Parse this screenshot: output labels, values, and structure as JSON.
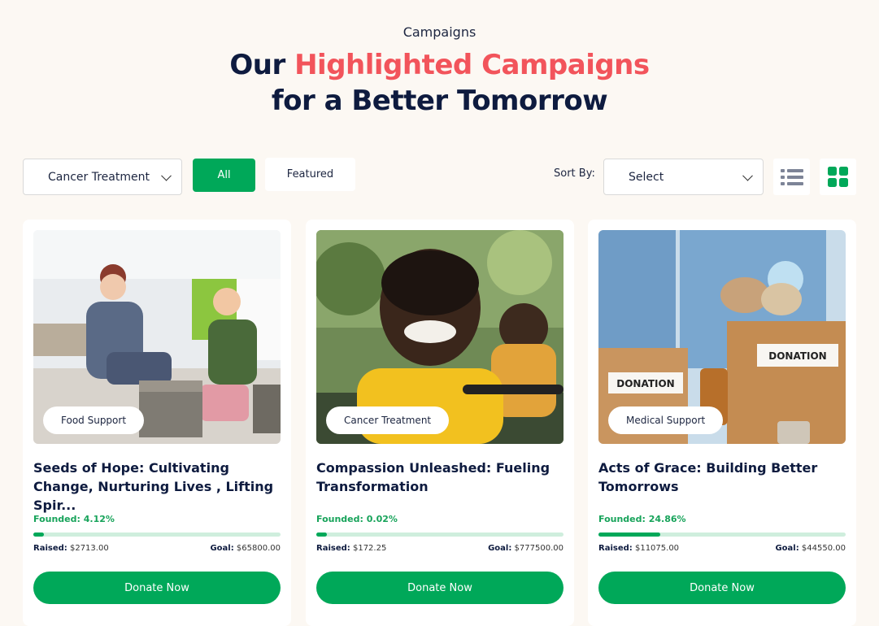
{
  "header": {
    "eyebrow": "Campaigns",
    "title_prefix": "Our",
    "title_accent": "Highlighted Campaigns",
    "title_line2": "for a Better Tomorrow"
  },
  "filters": {
    "category_value": "Cancer Treatment",
    "all_label": "All",
    "featured_label": "Featured",
    "sort_label": "Sort By:",
    "sort_value": "Select"
  },
  "colors": {
    "accent": "#f2545b",
    "brand_green": "#00a859",
    "navy": "#0e1b3f"
  },
  "campaigns": [
    {
      "tag": "Food Support",
      "title": "Seeds of Hope: Cultivating Change, Nurturing Lives , Lifting Spir...",
      "founded_label": "Founded:",
      "founded_value": "4.12%",
      "progress_pct": 4.12,
      "raised_label": "Raised:",
      "raised_value": "$2713.00",
      "goal_label": "Goal:",
      "goal_value": "$65800.00",
      "button": "Donate Now"
    },
    {
      "tag": "Cancer Treatment",
      "title": "Compassion Unleashed: Fueling Transformation",
      "founded_label": "Founded:",
      "founded_value": "0.02%",
      "progress_pct": 0.02,
      "raised_label": "Raised:",
      "raised_value": "$172.25",
      "goal_label": "Goal:",
      "goal_value": "$777500.00",
      "button": "Donate Now"
    },
    {
      "tag": "Medical Support",
      "title": "Acts of Grace: Building Better Tomorrows",
      "founded_label": "Founded:",
      "founded_value": "24.86%",
      "progress_pct": 24.86,
      "raised_label": "Raised:",
      "raised_value": "$11075.00",
      "goal_label": "Goal:",
      "goal_value": "$44550.00",
      "button": "Donate Now",
      "image_text": "DONATION"
    }
  ]
}
